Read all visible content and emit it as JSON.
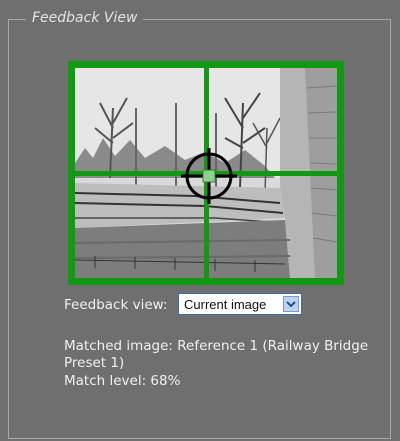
{
  "panel": {
    "legend": "Feedback View"
  },
  "feedback": {
    "label": "Feedback view:",
    "selected": "Current image"
  },
  "matched": {
    "line1": "Matched image: Reference 1 (Railway Bridge",
    "line2": "Preset 1)",
    "match_level": "Match level: 68%"
  },
  "colors": {
    "grid": "#119a11",
    "panel_bg": "#6f6f6f"
  },
  "icons": {
    "crosshair": "crosshair-icon",
    "dropdown": "chevron-down-icon"
  }
}
